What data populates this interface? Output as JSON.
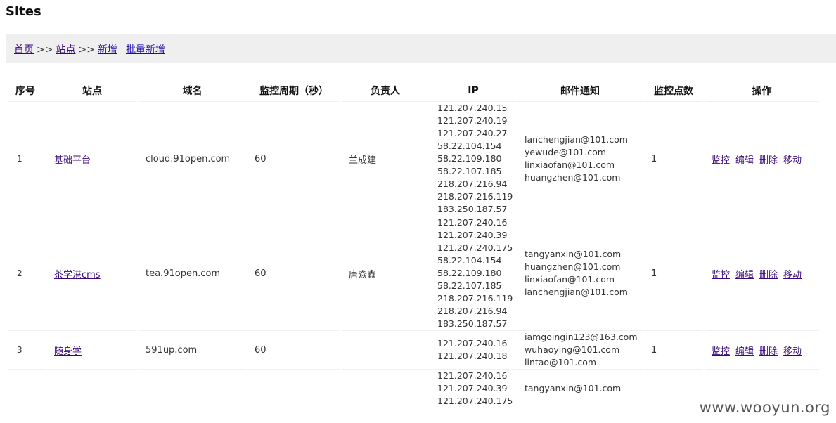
{
  "page": {
    "title": "Sites"
  },
  "breadcrumb": {
    "home": "首页",
    "sites": "站点",
    "new": "新增",
    "batch_new": "批量新增",
    "separator": ">>"
  },
  "table": {
    "headers": [
      "序号",
      "站点",
      "域名",
      "监控周期（秒）",
      "负责人",
      "IP",
      "邮件通知",
      "监控点数",
      "操作"
    ],
    "actions": [
      "监控",
      "编辑",
      "删除",
      "移动"
    ],
    "rows": [
      {
        "index": "1",
        "site": "基础平台",
        "domain": "cloud.91open.com",
        "period": "60",
        "owner": "兰成建",
        "ips": [
          "121.207.240.15",
          "121.207.240.19",
          "121.207.240.27",
          "58.22.104.154",
          "58.22.109.180",
          "58.22.107.185",
          "218.207.216.94",
          "218.207.216.119",
          "183.250.187.57"
        ],
        "emails": [
          "lanchengjian@101.com",
          "yewude@101.com",
          "linxiaofan@101.com",
          "huangzhen@101.com"
        ],
        "points": "1"
      },
      {
        "index": "2",
        "site": "茶学港cms",
        "domain": "tea.91open.com",
        "period": "60",
        "owner": "唐焱鑫",
        "ips": [
          "121.207.240.16",
          "121.207.240.39",
          "121.207.240.175",
          "58.22.104.154",
          "58.22.109.180",
          "58.22.107.185",
          "218.207.216.119",
          "218.207.216.94",
          "183.250.187.57"
        ],
        "emails": [
          "tangyanxin@101.com",
          "huangzhen@101.com",
          "linxiaofan@101.com",
          "lanchengjian@101.com"
        ],
        "points": "1"
      },
      {
        "index": "3",
        "site": "随身学",
        "domain": "591up.com",
        "period": "60",
        "owner": "",
        "ips": [
          "121.207.240.16",
          "121.207.240.18"
        ],
        "emails": [
          "iamgoingin123@163.com",
          "wuhaoying@101.com",
          "lintao@101.com"
        ],
        "points": "1"
      },
      {
        "index": "",
        "site": "",
        "domain": "",
        "period": "",
        "owner": "",
        "ips": [
          "121.207.240.16",
          "121.207.240.39",
          "121.207.240.175"
        ],
        "emails": [
          "",
          "",
          "tangyanxin@101.com"
        ],
        "points": ""
      }
    ]
  },
  "watermark": "www.wooyun.org"
}
